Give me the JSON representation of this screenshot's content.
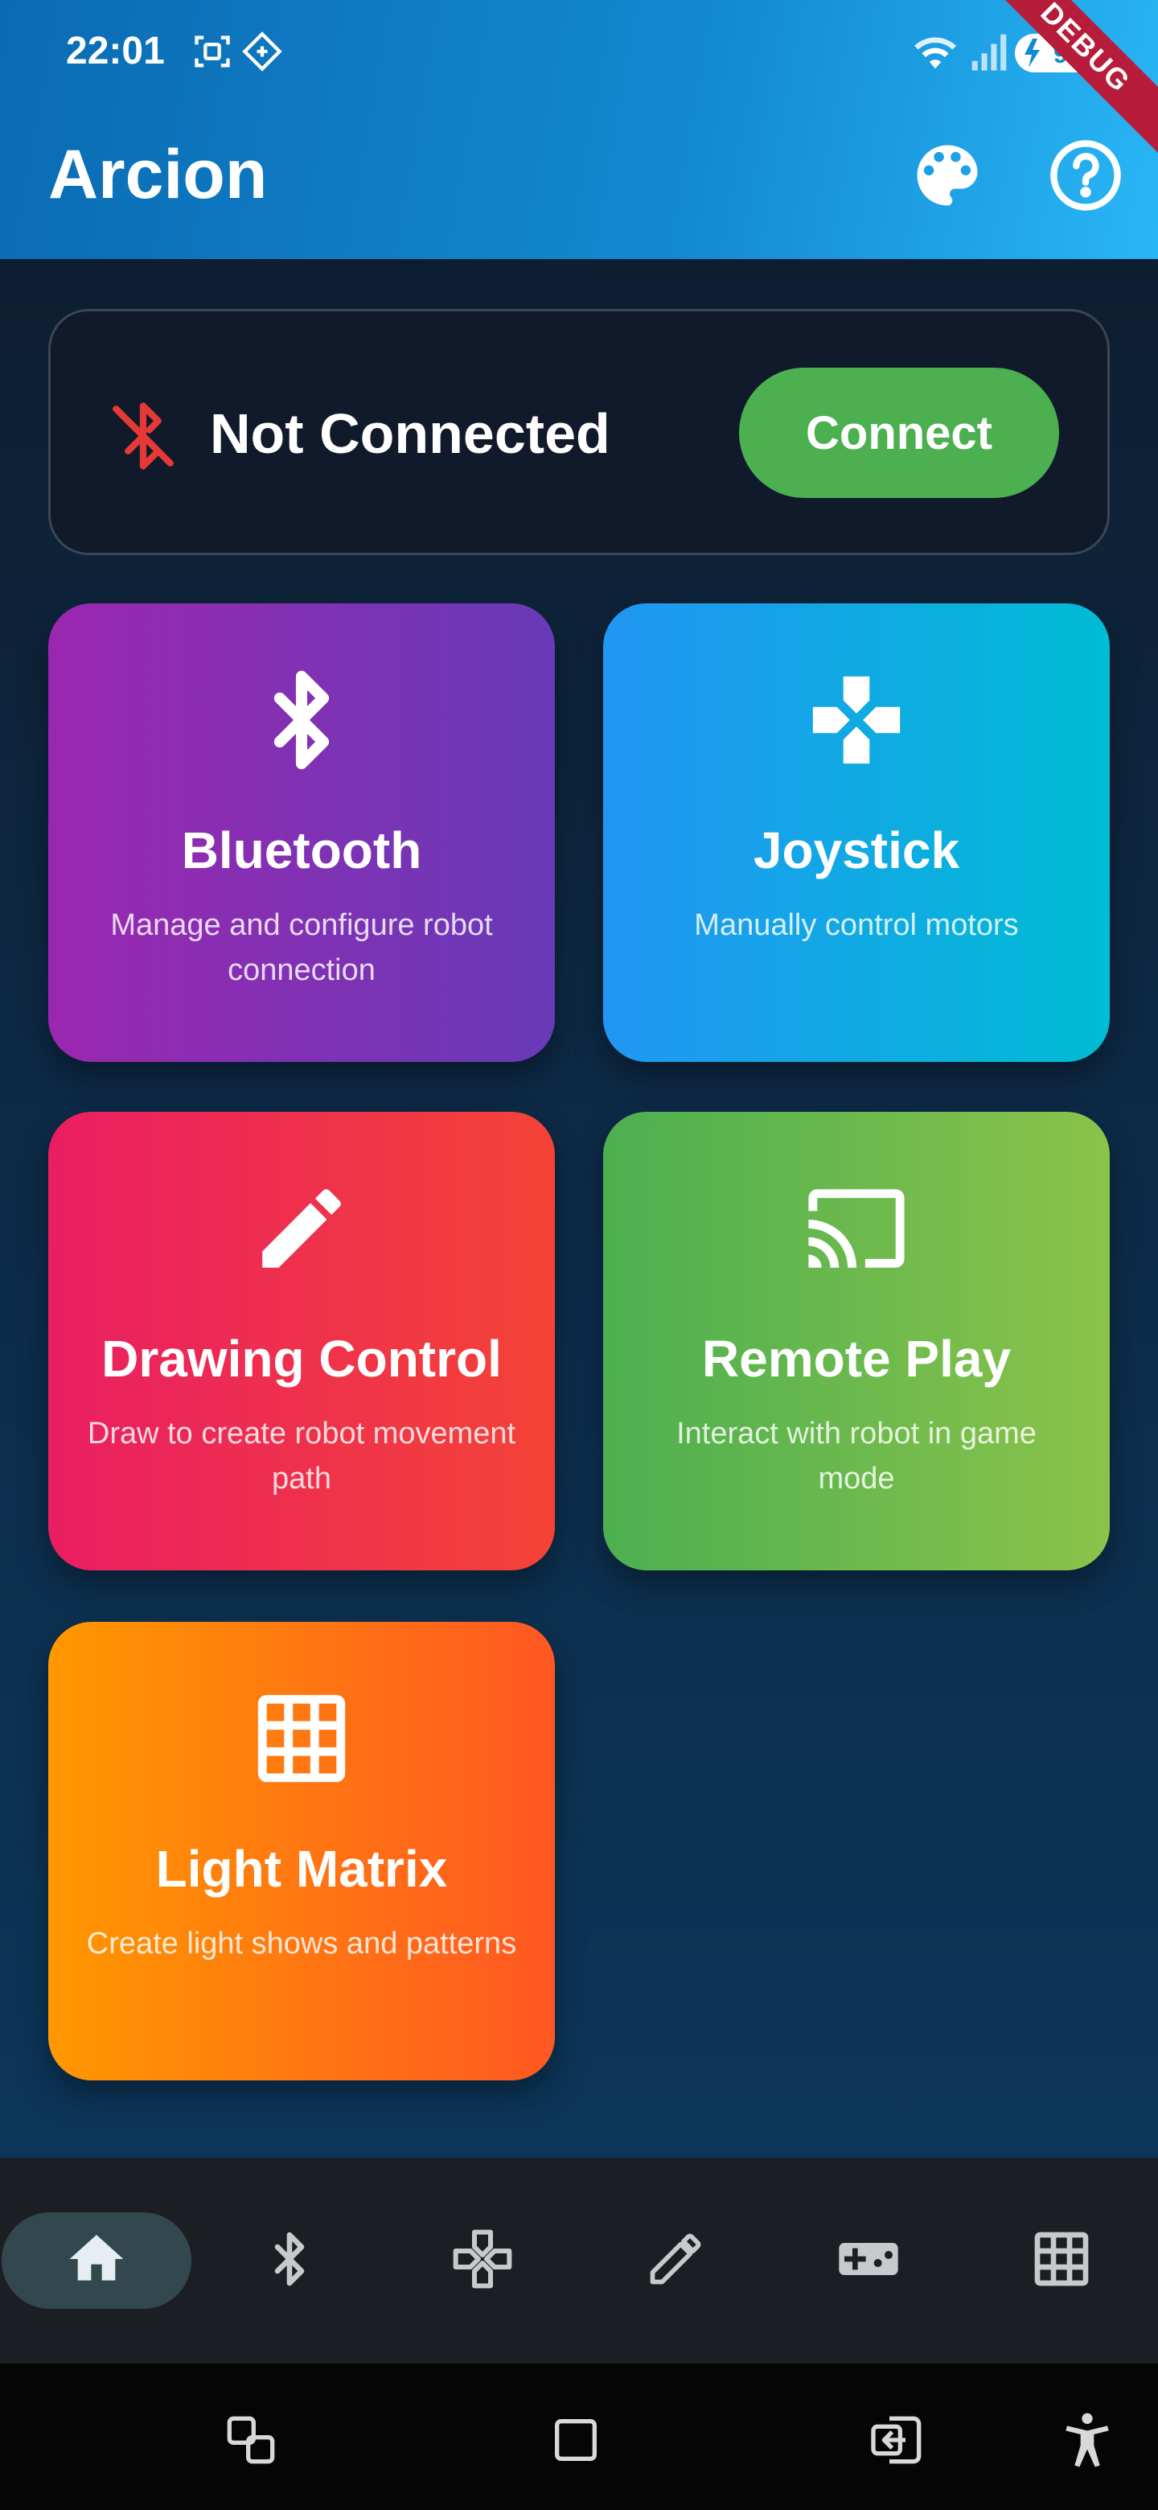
{
  "status_bar": {
    "time": "22:01",
    "battery": "91",
    "icons": [
      "screenshot-icon",
      "assistant-icon",
      "wifi-icon",
      "signal-icon",
      "battery-icon"
    ]
  },
  "app_bar": {
    "title": "Arcion",
    "actions": [
      "palette-icon",
      "help-icon"
    ],
    "debug_banner": "DEBUG",
    "gradient": [
      "#0a6bb3",
      "#29b6f6"
    ]
  },
  "connection": {
    "status": "Not Connected",
    "button_label": "Connect",
    "status_icon": "bluetooth-disabled-icon",
    "status_color": "#e53935",
    "button_color": "#4caf50"
  },
  "features": [
    {
      "title": "Bluetooth",
      "description": "Manage and configure robot connection",
      "icon": "bluetooth-icon",
      "colors": [
        "#9b27b0",
        "#673ab7"
      ]
    },
    {
      "title": "Joystick",
      "description": "Manually control motors",
      "icon": "gamepad-cross-icon",
      "colors": [
        "#2196f3",
        "#00bcd4"
      ]
    },
    {
      "title": "Drawing Control",
      "description": "Draw to create robot movement path",
      "icon": "pencil-icon",
      "colors": [
        "#e91e63",
        "#f44336"
      ]
    },
    {
      "title": "Remote Play",
      "description": "Interact with robot in game mode",
      "icon": "cast-icon",
      "colors": [
        "#4caf50",
        "#8bc34a"
      ]
    },
    {
      "title": "Light Matrix",
      "description": "Create light shows and patterns",
      "icon": "grid-icon",
      "colors": [
        "#ff9800",
        "#ff5722"
      ]
    }
  ],
  "bottom_nav": {
    "selected": "home",
    "items": [
      "home-icon",
      "bluetooth-icon",
      "gamepad-cross-icon",
      "pencil-icon",
      "gamepad-icon",
      "grid-icon"
    ]
  },
  "system_nav": [
    "recents-icon",
    "home-square-icon",
    "back-icon",
    "accessibility-icon"
  ]
}
